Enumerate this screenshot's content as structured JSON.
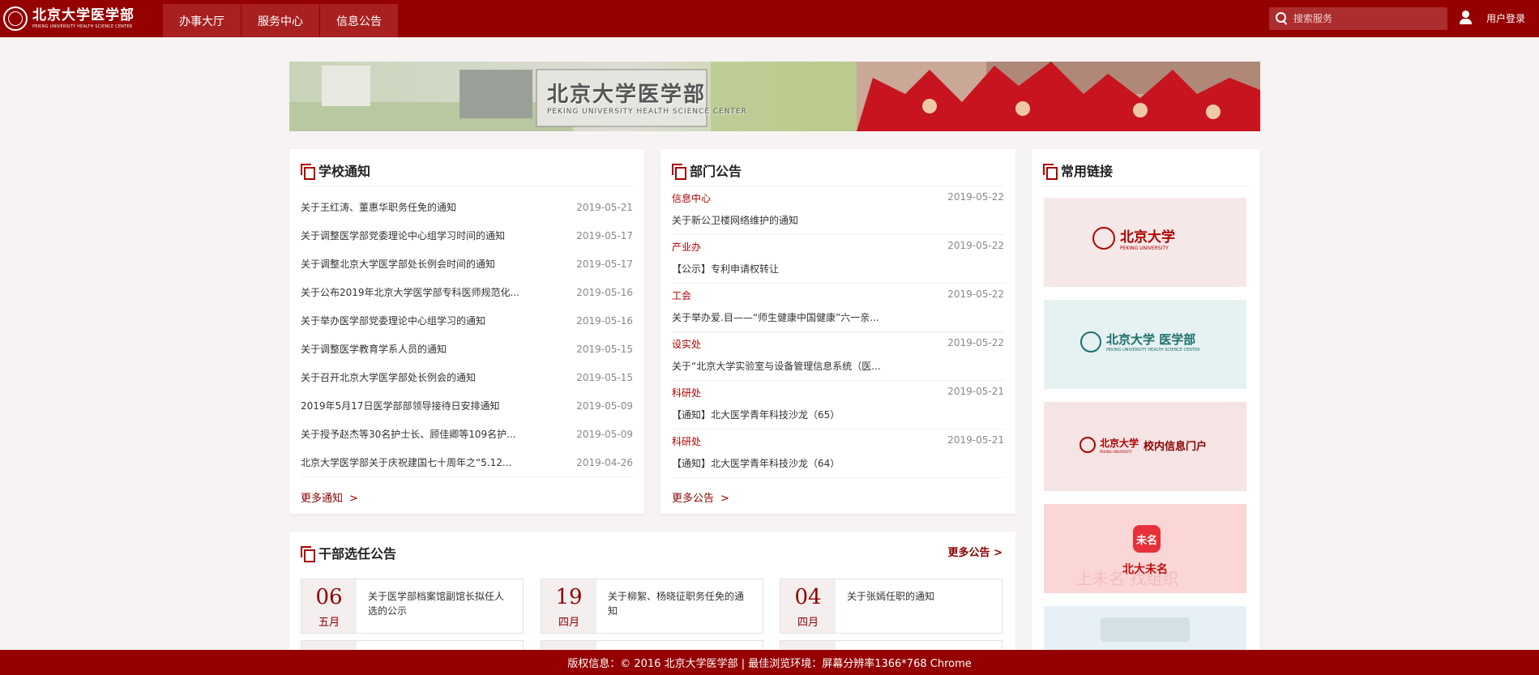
{
  "header": {
    "logo": {
      "cn": "北京大学医学部",
      "en": "PEKING UNIVERSITY HEALTH SCIENCE CENTER"
    },
    "nav": [
      {
        "label": "办事大厅"
      },
      {
        "label": "服务中心"
      },
      {
        "label": "信息公告"
      }
    ],
    "search": {
      "placeholder": "搜索服务"
    },
    "login_label": "用户登录"
  },
  "banner": {
    "sign_cn": "北京大学医学部",
    "sign_en": "PEKING UNIVERSITY HEALTH SCIENCE CENTER"
  },
  "school_notices": {
    "title": "学校通知",
    "items": [
      {
        "title": "关于王红涛、董惠华职务任免的通知",
        "date": "2019-05-21"
      },
      {
        "title": "关于调整医学部党委理论中心组学习时间的通知",
        "date": "2019-05-17"
      },
      {
        "title": "关于调整北京大学医学部处长例会时间的通知",
        "date": "2019-05-17"
      },
      {
        "title": "关于公布2019年北京大学医学部专科医师规范化...",
        "date": "2019-05-16"
      },
      {
        "title": "关于举办医学部党委理论中心组学习的通知",
        "date": "2019-05-16"
      },
      {
        "title": "关于调整医学教育学系人员的通知",
        "date": "2019-05-15"
      },
      {
        "title": "关于召开北京大学医学部处长例会的通知",
        "date": "2019-05-15"
      },
      {
        "title": "2019年5月17日医学部部领导接待日安排通知",
        "date": "2019-05-09"
      },
      {
        "title": "关于授予赵杰等30名护士长、顾佳卿等109名护...",
        "date": "2019-05-09"
      },
      {
        "title": "北京大学医学部关于庆祝建国七十周年之“5.12...",
        "date": "2019-04-26"
      }
    ],
    "more": "更多通知",
    "more_arrow": ">"
  },
  "dept_notices": {
    "title": "部门公告",
    "items": [
      {
        "dept": "信息中心",
        "date": "2019-05-22",
        "title": "关于新公卫楼网络维护的通知"
      },
      {
        "dept": "产业办",
        "date": "2019-05-22",
        "title": "【公示】专利申请权转让"
      },
      {
        "dept": "工会",
        "date": "2019-05-22",
        "title": "关于举办爱.目——“师生健康中国健康”六一亲..."
      },
      {
        "dept": "设实处",
        "date": "2019-05-22",
        "title": "关于“北京大学实验室与设备管理信息系统（医..."
      },
      {
        "dept": "科研处",
        "date": "2019-05-21",
        "title": "【通知】北大医学青年科技沙龙（65）"
      },
      {
        "dept": "科研处",
        "date": "2019-05-21",
        "title": "【通知】北大医学青年科技沙龙（64）"
      }
    ],
    "more": "更多公告",
    "more_arrow": ">"
  },
  "links": {
    "title": "常用链接",
    "items": [
      {
        "cn": "北京大学",
        "en": "PEKING UNIVERSITY",
        "color": "#b00000",
        "bg": "#f6e8e8"
      },
      {
        "cn": "北京大学 医学部",
        "en": "PEKING UNIVERSITY HEALTH SCIENCE CENTER",
        "color": "#1d6e6e",
        "bg": "#e6f1f1"
      },
      {
        "cn": "北京大学",
        "en": "PEKING UNIVERSITY",
        "sub": "校内信息门户",
        "color": "#b00000",
        "bg": "#f5e4e4"
      },
      {
        "app_icon": "未名",
        "cn": "北大未名",
        "watermark": "上未名  找组织",
        "color": "#c01010",
        "bg": "#fbd6d6"
      }
    ]
  },
  "cadre": {
    "title": "干部选任公告",
    "more": "更多公告",
    "more_arrow": ">",
    "items": [
      {
        "day": "06",
        "month": "五月",
        "title": "关于医学部档案馆副馆长拟任人选的公示"
      },
      {
        "day": "19",
        "month": "四月",
        "title": "关于柳絮、杨晓征职务任免的通知"
      },
      {
        "day": "04",
        "month": "四月",
        "title": "关于张嫣任职的通知"
      }
    ]
  },
  "footer": {
    "text": "版权信息：© 2016 北京大学医学部 | 最佳浏览环境：屏幕分辨率1366*768 Chrome"
  }
}
